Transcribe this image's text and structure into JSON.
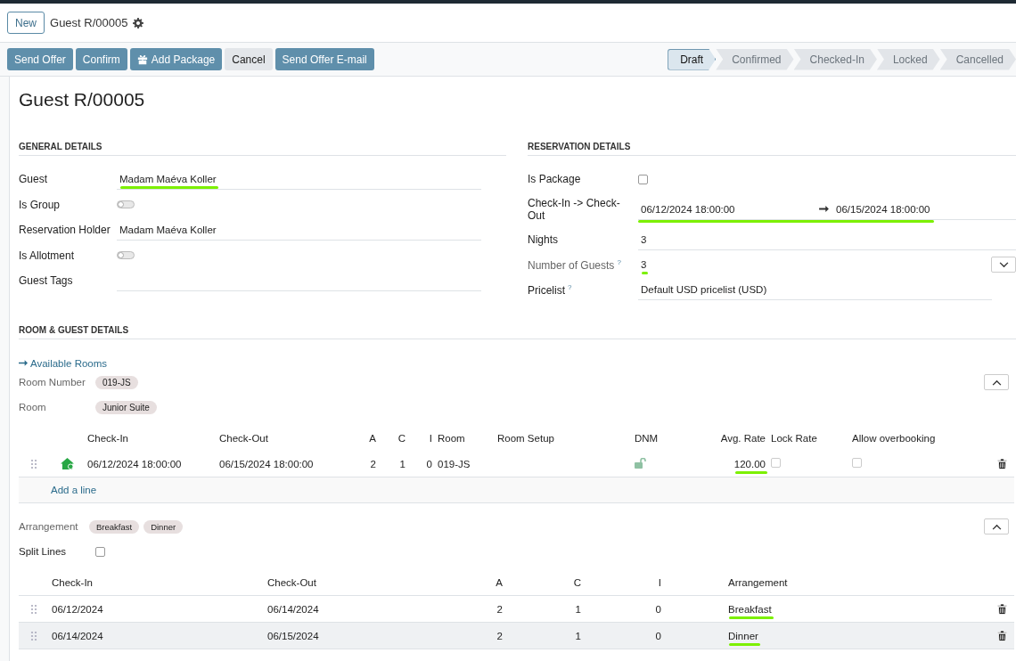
{
  "breadcrumb": {
    "new_button": "New",
    "title": "Guest R/00005"
  },
  "action_buttons": [
    {
      "label": "Send Offer",
      "kind": "primary",
      "has_icon": false
    },
    {
      "label": "Confirm",
      "kind": "primary",
      "has_icon": false
    },
    {
      "label": "Add Package",
      "kind": "primary",
      "has_icon": true
    },
    {
      "label": "Cancel",
      "kind": "secondary",
      "has_icon": false
    },
    {
      "label": "Send Offer E-mail",
      "kind": "primary",
      "has_icon": false
    }
  ],
  "statusbar": [
    {
      "label": "Draft",
      "selected": true
    },
    {
      "label": "Confirmed",
      "selected": false
    },
    {
      "label": "Checked-In",
      "selected": false
    },
    {
      "label": "Locked",
      "selected": false
    },
    {
      "label": "Cancelled",
      "selected": false
    }
  ],
  "title": "Guest R/00005",
  "general_details": {
    "heading": "GENERAL DETAILS",
    "fields": [
      {
        "label": "Guest",
        "kind": "text",
        "value": "Madam Maéva Koller",
        "underlined": true
      },
      {
        "label": "Is Group",
        "kind": "toggle",
        "on": false
      },
      {
        "label": "Reservation Holder",
        "kind": "text",
        "value": "Madam Maéva Koller",
        "underlined": false
      },
      {
        "label": "Is Allotment",
        "kind": "toggle",
        "on": false
      },
      {
        "label": "Guest Tags",
        "kind": "text"
      }
    ]
  },
  "reservation_details": {
    "heading": "RESERVATION DETAILS",
    "fields": [
      {
        "label": "Is Package",
        "kind": "checkbox",
        "checked": false
      },
      {
        "label": "Check-In -> Check-Out",
        "kind": "daterange",
        "start": "06/12/2024 18:00:00",
        "end": "06/15/2024 18:00:00",
        "underlined": true
      },
      {
        "label": "Nights",
        "kind": "text",
        "value": "3",
        "underlined": false
      },
      {
        "label": "Number of Guests",
        "kind": "select",
        "help": "?",
        "value": "3",
        "underlined": true
      },
      {
        "label": "Pricelist",
        "kind": "text",
        "help": "?",
        "value": "Default USD pricelist (USD)",
        "underlined": false
      }
    ]
  },
  "room_guest_details": {
    "heading": "ROOM & GUEST DETAILS",
    "link": "Available Rooms",
    "room_number": {
      "label": "Room Number",
      "tags": [
        "019-JS"
      ]
    },
    "room": {
      "label": "Room",
      "tags": [
        "Junior Suite"
      ]
    },
    "rooms_table": {
      "columns": [
        "Check-In",
        "Check-Out",
        "A",
        "C",
        "I",
        "Room",
        "Room Setup",
        "DNM",
        "Avg. Rate",
        "Lock Rate",
        "Allow overbooking"
      ],
      "rows": [
        {
          "check_in": "06/12/2024 18:00:00",
          "check_out": "06/15/2024 18:00:00",
          "a": "2",
          "c": "1",
          "i": "0",
          "room": "019-JS",
          "dnm_locked": false,
          "avg_rate": "120.00",
          "avg_rate_underlined": true,
          "lock_rate": false,
          "allow_overbooking": false
        }
      ],
      "add_line": "Add a line"
    },
    "arrangement": {
      "label": "Arrangement",
      "tags": [
        "Breakfast",
        "Dinner"
      ]
    },
    "split_lines": {
      "label": "Split Lines",
      "checked": false
    },
    "arrangement_table": {
      "columns": [
        "Check-In",
        "Check-Out",
        "A",
        "C",
        "I",
        "Arrangement"
      ],
      "rows": [
        {
          "check_in": "06/12/2024",
          "check_out": "06/14/2024",
          "a": "2",
          "c": "1",
          "i": "0",
          "arrangement": "Breakfast",
          "underlined": true,
          "hovered": false
        },
        {
          "check_in": "06/14/2024",
          "check_out": "06/15/2024",
          "a": "2",
          "c": "1",
          "i": "0",
          "arrangement": "Dinner",
          "underlined": true,
          "hovered": true
        }
      ]
    }
  }
}
